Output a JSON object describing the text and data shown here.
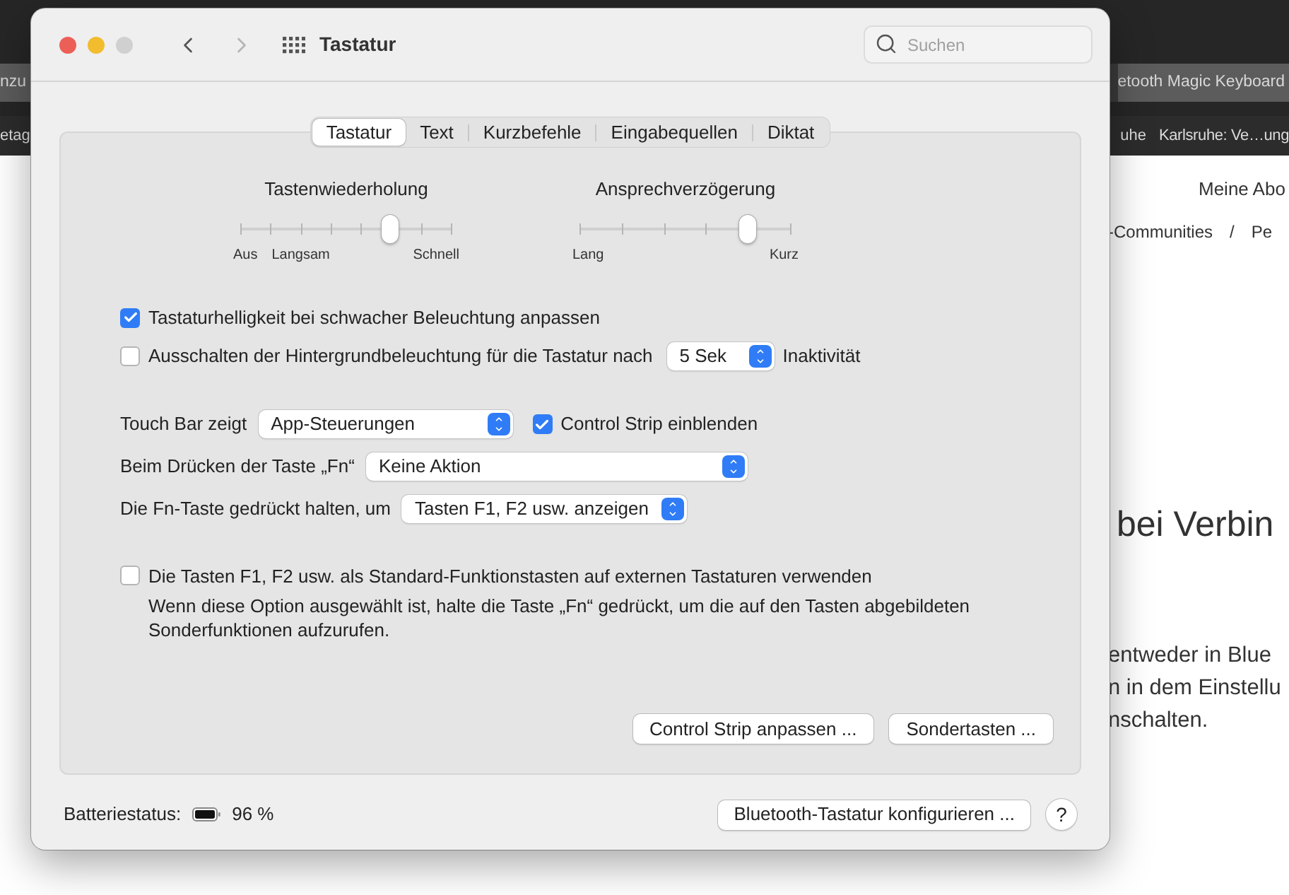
{
  "browser": {
    "tabs": [
      {
        "label": "nzu"
      },
      {
        "label": "etooth Magic Keyboard"
      }
    ],
    "bookmarks": [
      "etag",
      "uhe",
      "Karlsruhe: Ve…ung"
    ],
    "page": {
      "nav_link": "Meine Abo",
      "breadcrumb": [
        "-Communities",
        "/",
        "Pe"
      ],
      "heading": "bei Verbin",
      "body_lines": [
        "entweder in Blue",
        "n in dem Einstellu",
        "nschalten."
      ]
    }
  },
  "window": {
    "title": "Tastatur",
    "search": {
      "placeholder": "Suchen"
    },
    "tabs": [
      {
        "label": "Tastatur",
        "selected": true
      },
      {
        "label": "Text",
        "selected": false
      },
      {
        "label": "Kurzbefehle",
        "selected": false
      },
      {
        "label": "Eingabequellen",
        "selected": false
      },
      {
        "label": "Diktat",
        "selected": false
      }
    ],
    "sliders": [
      {
        "title": "Tastenwiederholung",
        "level": 0.714,
        "labels": [
          "Aus",
          "Langsam",
          "Schnell"
        ]
      },
      {
        "title": "Ansprechverzögerung",
        "level": 0.8,
        "labels": [
          "Lang",
          "Kurz"
        ]
      }
    ],
    "checks": [
      {
        "kind": "plain",
        "label": "Tastaturhelligkeit bei schwacher Beleuchtung anpassen",
        "checked": true
      },
      {
        "kind": "timeout",
        "label": "Ausschalten der Hintergrundbeleuchtung für die Tastatur nach",
        "checked": false,
        "popup": "5 Sek",
        "suffix": "Inaktivität"
      }
    ],
    "options": [
      {
        "label": "Touch Bar zeigt",
        "popup": "App-Steuerungen",
        "check": {
          "label": "Control Strip einblenden",
          "checked": true
        }
      },
      {
        "label": "Beim Drücken der Taste „Fn“",
        "popup": "Keine Aktion"
      },
      {
        "label": "Die Fn-Taste gedrückt halten, um",
        "popup": "Tasten F1, F2 usw. anzeigen"
      }
    ],
    "function_keys": {
      "label": "Die Tasten F1, F2 usw. als Standard-Funktionstasten auf externen Tastaturen verwenden",
      "checked": false,
      "description": "Wenn diese Option ausgewählt ist, halte die Taste „Fn“ gedrückt, um die auf den Tasten abgebildeten Sonderfunktionen aufzurufen."
    },
    "buttons": [
      "Control Strip anpassen ...",
      "Sondertasten ..."
    ],
    "footer": {
      "battery_label": "Batteriestatus:",
      "battery_value": "96 %",
      "button": "Bluetooth-Tastatur konfigurieren ...",
      "help": "?"
    }
  }
}
